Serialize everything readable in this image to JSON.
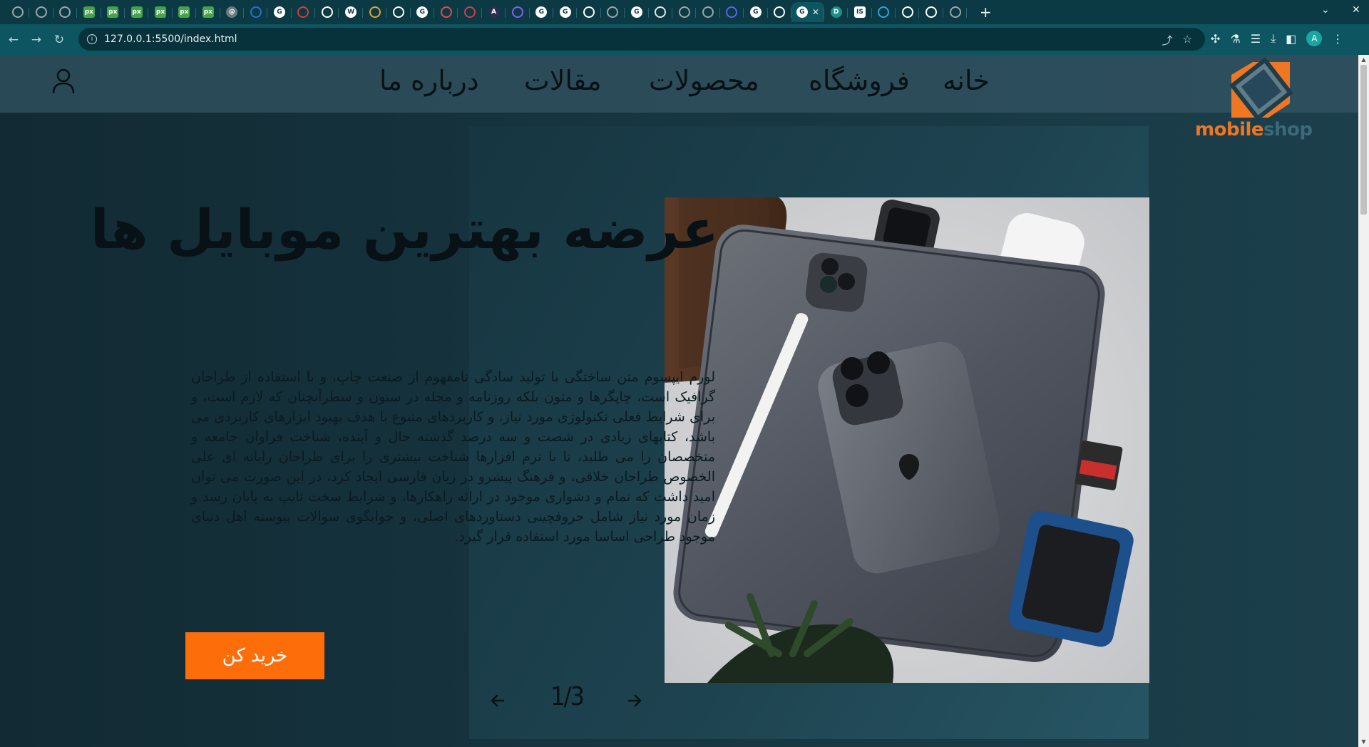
{
  "browser": {
    "tabs": [
      {
        "icon": "chrome-icon",
        "color": "#9aa7ab",
        "letter": ""
      },
      {
        "icon": "history-icon",
        "color": "#9aa7ab",
        "letter": ""
      },
      {
        "icon": "chrome-icon",
        "color": "#9aa7ab",
        "letter": ""
      },
      {
        "icon": "px-icon",
        "color": "#45a34a",
        "letter": "px"
      },
      {
        "icon": "px-icon",
        "color": "#45a34a",
        "letter": "px"
      },
      {
        "icon": "px-icon",
        "color": "#45a34a",
        "letter": "px"
      },
      {
        "icon": "px-icon",
        "color": "#45a34a",
        "letter": "px"
      },
      {
        "icon": "px-icon",
        "color": "#45a34a",
        "letter": "px"
      },
      {
        "icon": "px-icon",
        "color": "#45a34a",
        "letter": "px"
      },
      {
        "icon": "openai-icon",
        "color": "#6c7a7e",
        "letter": "@"
      },
      {
        "icon": "edge-icon",
        "color": "#2b6fd6",
        "letter": ""
      },
      {
        "icon": "google-icon",
        "color": "#ffffff",
        "letter": "G"
      },
      {
        "icon": "bug-icon",
        "color": "#d83b3b",
        "letter": ""
      },
      {
        "icon": "chrome-icon",
        "color": "#ffffff",
        "letter": ""
      },
      {
        "icon": "wikipedia-icon",
        "color": "#ffffff",
        "letter": "W"
      },
      {
        "icon": "bolt-icon",
        "color": "#e5a32b",
        "letter": ""
      },
      {
        "icon": "chrome-icon",
        "color": "#ffffff",
        "letter": ""
      },
      {
        "icon": "google-icon",
        "color": "#ffffff",
        "letter": "G"
      },
      {
        "icon": "brush-icon",
        "color": "#e8464f",
        "letter": ""
      },
      {
        "icon": "circle-icon",
        "color": "#d93a49",
        "letter": ""
      },
      {
        "icon": "a-icon",
        "color": "#2d2d4f",
        "letter": "A"
      },
      {
        "icon": "sparkle-icon",
        "color": "#8a5cf6",
        "letter": ""
      },
      {
        "icon": "google-icon",
        "color": "#ffffff",
        "letter": "G"
      },
      {
        "icon": "google-icon",
        "color": "#ffffff",
        "letter": "G"
      },
      {
        "icon": "github-icon",
        "color": "#ffffff",
        "letter": ""
      },
      {
        "icon": "chrome-icon",
        "color": "#9aa7ab",
        "letter": ""
      },
      {
        "icon": "google-icon",
        "color": "#ffffff",
        "letter": "G"
      },
      {
        "icon": "docs-icon",
        "color": "#dfe8ea",
        "letter": ""
      },
      {
        "icon": "chrome-icon",
        "color": "#9aa7ab",
        "letter": ""
      },
      {
        "icon": "chrome-icon",
        "color": "#9aa7ab",
        "letter": ""
      },
      {
        "icon": "blob-icon",
        "color": "#5b63e8",
        "letter": ""
      },
      {
        "icon": "google-icon",
        "color": "#ffffff",
        "letter": "G"
      },
      {
        "icon": "chrome-icon",
        "color": "#ffffff",
        "letter": ""
      },
      {
        "icon": "google-icon",
        "color": "#ffffff",
        "letter": "G"
      },
      {
        "icon": "d-icon",
        "color": "#1a8f8a",
        "letter": "D"
      },
      {
        "icon": "is-icon",
        "color": "#ffffff",
        "letter": "IS"
      },
      {
        "icon": "telegram-icon",
        "color": "#2aa3e0",
        "letter": ""
      },
      {
        "icon": "chrome-icon",
        "color": "#ffffff",
        "letter": ""
      },
      {
        "icon": "chrome-icon",
        "color": "#ffffff",
        "letter": ""
      },
      {
        "icon": "chrome-icon",
        "color": "#9aa7ab",
        "letter": ""
      }
    ],
    "active_tab_index": 33,
    "url": "127.0.0.1:5500/index.html",
    "profile_initial": "A"
  },
  "site": {
    "nav": [
      {
        "label": "خانه",
        "name": "nav-home"
      },
      {
        "label": "فروشگاه",
        "name": "nav-shop"
      },
      {
        "label": "محصولات",
        "name": "nav-products"
      },
      {
        "label": "مقالات",
        "name": "nav-articles"
      },
      {
        "label": "درباره ما",
        "name": "nav-about"
      }
    ],
    "logo": {
      "part1": "mobile",
      "part2": "shop"
    },
    "hero": {
      "title": "عرضه بهترین موبایل ها",
      "text": "لورم ایپسوم متن ساختگی با تولید سادگی نامفهوم از صنعت چاپ، و با استفاده از طراحان گرافیک است، چاپگرها و متون بلکه روزنامه و مجله در ستون و سطرآنچنان که لازم است، و برای شرایط فعلی تکنولوژی مورد نیاز، و کاربردهای متنوع با هدف بهبود ابزارهای کاربردی می باشد، کتابهای زیادی در شصت و سه درصد گذشته حال و آینده، شناخت فراوان جامعه و متخصصان را می طلبد، تا با نرم افزارها شناخت بیشتری را برای طراحان رایانه ای علی الخصوص طراحان خلاقی، و فرهنگ پیشرو در زبان فارسی ایجاد کرد، در این صورت می توان امید داشت که تمام و دشواری موجود در ارائه راهکارها، و شرایط سخت تایپ به پایان رسد و زمان مورد نیاز شامل حروفچینی دستاوردهای اصلی، و جوابگوی سوالات پیوسته اهل دنیای موجود طراحی اساسا مورد استفاده قرار گیرد.",
      "button": "خرید کن",
      "counter": "1/3"
    },
    "colors": {
      "accent": "#fd6e0a",
      "header": "#2c4c5a",
      "background": "#112a33",
      "text": "#081216"
    }
  }
}
